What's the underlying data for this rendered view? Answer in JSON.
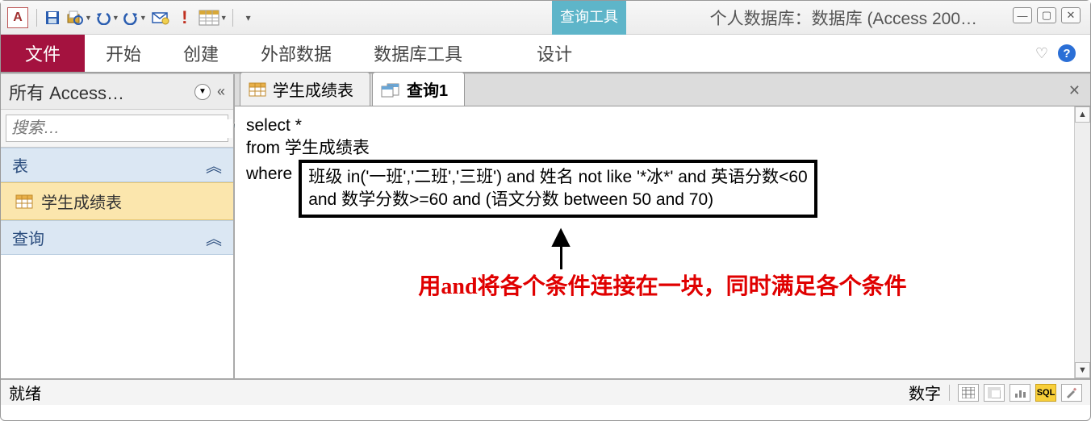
{
  "window": {
    "logo": "A",
    "title": "个人数据库：数据库 (Access 200…"
  },
  "context_tab": "查询工具",
  "ribbon": {
    "file": "文件",
    "tabs": [
      "开始",
      "创建",
      "外部数据",
      "数据库工具"
    ],
    "design": "设计"
  },
  "nav": {
    "title": "所有 Access…",
    "search_placeholder": "搜索…",
    "group_tables": "表",
    "item_table": "学生成绩表",
    "group_queries": "查询"
  },
  "doc_tabs": {
    "tab1": "学生成绩表",
    "tab2": "查询1"
  },
  "sql": {
    "line1": "select *",
    "line2": "from 学生成绩表",
    "where": "where",
    "clause1": "班级 in('一班','二班','三班') and 姓名 not like '*冰*'  and 英语分数<60",
    "clause2": " and 数学分数>=60 and (语文分数 between 50 and 70)"
  },
  "annotation": "用and将各个条件连接在一块，同时满足各个条件",
  "status": {
    "left": "就绪",
    "right": "数字",
    "sql": "SQL"
  },
  "icons": {
    "collapse": "«",
    "dropdown": "▼",
    "group_collapse": "︽",
    "close": "✕",
    "scroll_up": "▲",
    "scroll_down": "▼",
    "help": "?",
    "heart": "♡",
    "excl": "!"
  }
}
